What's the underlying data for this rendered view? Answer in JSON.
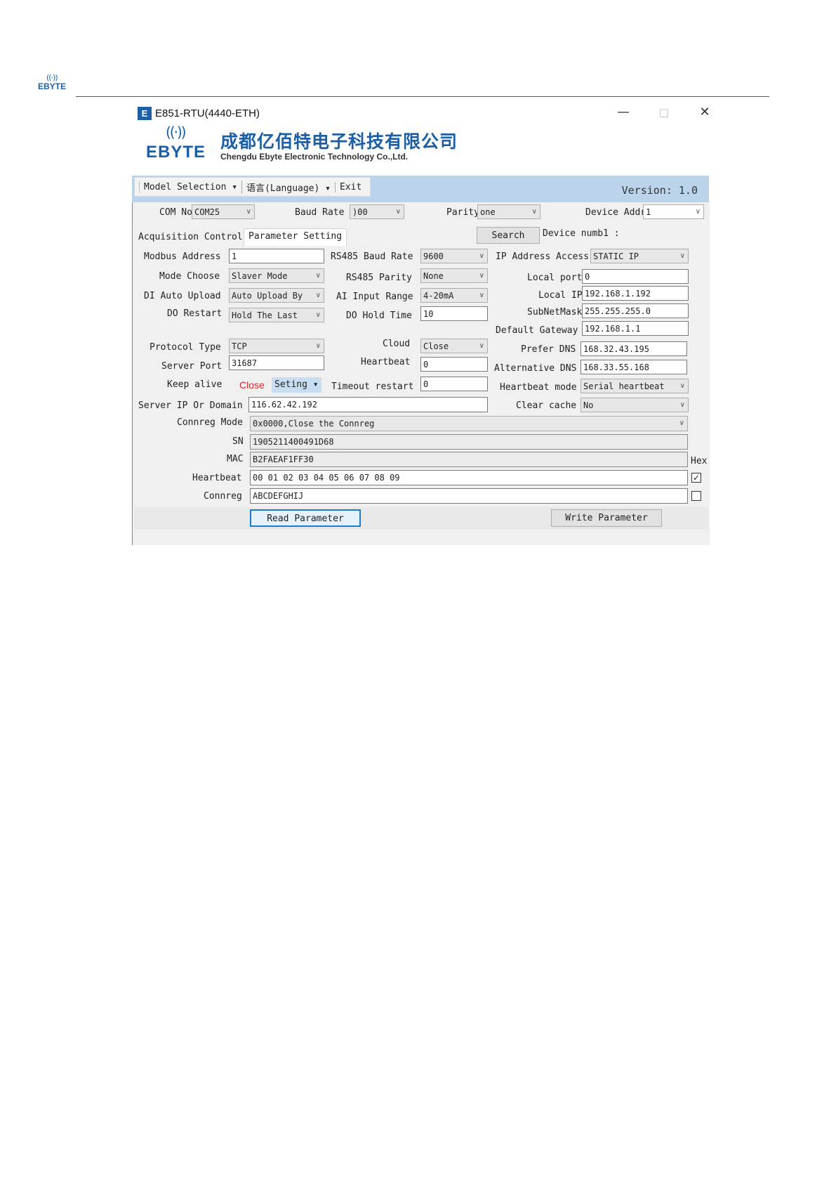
{
  "page_header": {
    "logo_text": "EBYTE"
  },
  "window": {
    "icon_letter": "E",
    "title": "E851-RTU(4440-ETH)",
    "controls": {
      "minimize": "—",
      "maximize": "□",
      "close": "✕"
    }
  },
  "brand": {
    "logo_word": "EBYTE",
    "company_cn": "成都亿佰特电子科技有限公司",
    "company_en": "Chengdu Ebyte Electronic Technology Co.,Ltd."
  },
  "menu": {
    "items": [
      "Model Selection ▾",
      "语言(Language) ▾",
      "Exit"
    ],
    "version": "Version: 1.0"
  },
  "connection": {
    "com_label": "COM No",
    "com_value": "COM25",
    "baud_label": "Baud Rate",
    "baud_value": ")00",
    "parity_label": "Parity",
    "parity_value": "one",
    "device_addr_label": "Device Addr",
    "device_addr_value": "1"
  },
  "tabs": [
    "Acquisition Control",
    "Parameter Setting"
  ],
  "search": {
    "button": "Search",
    "device_num_label": "Device numb1 :"
  },
  "params": {
    "modbus_address_label": "Modbus Address",
    "modbus_address": "1",
    "mode_choose_label": "Mode Choose",
    "mode_choose": "Slaver Mode",
    "di_auto_upload_label": "DI Auto Upload",
    "di_auto_upload": "Auto Upload By",
    "do_restart_label": "DO Restart",
    "do_restart": "Hold The Last",
    "rs485_baud_label": "RS485 Baud Rate",
    "rs485_baud": "9600",
    "rs485_parity_label": "RS485 Parity",
    "rs485_parity": "None",
    "ai_input_label": "AI Input Range",
    "ai_input": "4-20mA",
    "do_hold_label": "DO Hold Time",
    "do_hold": "10",
    "ip_access_label": "IP Address Access",
    "ip_access": "STATIC IP",
    "local_port_label": "Local port",
    "local_port": "0",
    "local_ip_label": "Local IP",
    "local_ip": "192.168.1.192",
    "subnet_label": "SubNetMask",
    "subnet": "255.255.255.0",
    "gateway_label": "Default Gateway",
    "gateway": "192.168.1.1",
    "protocol_label": "Protocol Type",
    "protocol": "TCP",
    "server_port_label": "Server Port",
    "server_port": "31687",
    "keep_alive_label": "Keep alive",
    "keep_alive_close": "Close",
    "keep_alive_setting": "Seting ▾",
    "cloud_label": "Cloud",
    "cloud": "Close",
    "heartbeat_label": "Heartbeat",
    "heartbeat": "0",
    "timeout_label": "Timeout restart",
    "timeout": "0",
    "prefer_dns_label": "Prefer DNS",
    "prefer_dns": "168.32.43.195",
    "alt_dns_label": "Alternative DNS",
    "alt_dns": "168.33.55.168",
    "heartbeat_mode_label": "Heartbeat mode",
    "heartbeat_mode": "Serial heartbeat",
    "clear_cache_label": "Clear cache",
    "clear_cache": "No",
    "server_ip_label": "Server IP Or Domain",
    "server_ip": "116.62.42.192",
    "connreg_mode_label": "Connreg Mode",
    "connreg_mode": "0x0000,Close the Connreg",
    "sn_label": "SN",
    "sn": "1905211400491D68",
    "mac_label": "MAC",
    "mac": "B2FAEAF1FF30",
    "hex_label": "Hex",
    "heartbeat_data_label": "Heartbeat",
    "heartbeat_data": "00 01 02 03 04 05 06 07 08 09",
    "heartbeat_hex_checked": true,
    "connreg_label": "Connreg",
    "connreg": "ABCDEFGHIJ",
    "connreg_hex_checked": false
  },
  "actions": {
    "read": "Read Parameter",
    "write": "Write Parameter"
  }
}
